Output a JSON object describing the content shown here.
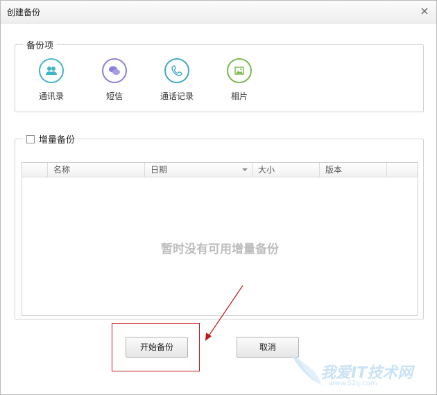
{
  "window": {
    "title": "创建备份"
  },
  "backup_items": {
    "legend": "备份项",
    "items": [
      {
        "label": "通讯录",
        "icon": "contacts-icon",
        "color": "#3fb6c6"
      },
      {
        "label": "短信",
        "icon": "sms-icon",
        "color": "#8a7fd6"
      },
      {
        "label": "通话记录",
        "icon": "call-log-icon",
        "color": "#3fa6c4"
      },
      {
        "label": "相片",
        "icon": "photo-icon",
        "color": "#78b84a"
      }
    ]
  },
  "incremental": {
    "legend": "增量备份",
    "checked": false,
    "columns": [
      "名称",
      "日期",
      "大小",
      "版本"
    ],
    "empty_message": "暂时没有可用增量备份"
  },
  "buttons": {
    "start": "开始备份",
    "cancel": "取消"
  },
  "watermark": {
    "text": "我爱IT技术网",
    "site": "www.52ij.com"
  }
}
